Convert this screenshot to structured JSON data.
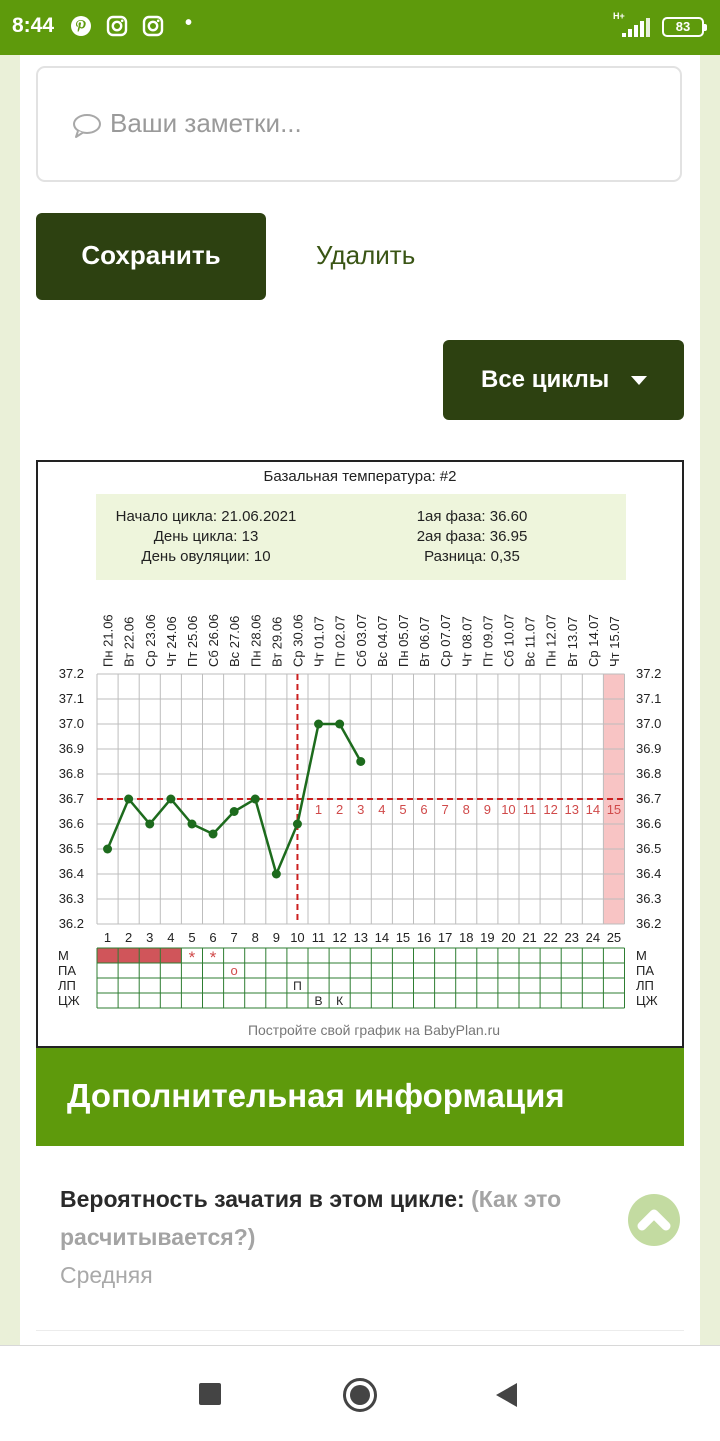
{
  "status_bar": {
    "time": "8:44",
    "network": "H+",
    "battery": "83",
    "icons": [
      "pinterest-icon",
      "instagram-icon",
      "instagram-icon",
      "dot-icon",
      "signal-icon",
      "battery-icon"
    ]
  },
  "notes": {
    "placeholder": "Ваши заметки...",
    "icon": "speech-bubble-icon"
  },
  "buttons": {
    "save": "Сохранить",
    "delete": "Удалить",
    "all_cycles": "Все циклы",
    "all_cycles_icon": "caret-down-icon"
  },
  "chart_data": {
    "type": "line",
    "title": "Базальная температура: #2",
    "info": {
      "cycle_start": "Начало цикла: 21.06.2021",
      "cycle_day": "День цикла: 13",
      "ovulation_day": "День овуляции: 10",
      "phase1": "1ая фаза: 36.60",
      "phase2": "2ая фаза: 36.95",
      "difference": "Разница: 0,35"
    },
    "weekdays": [
      "Пн",
      "Вт",
      "Ср",
      "Чт",
      "Пт",
      "Сб",
      "Вс",
      "Пн",
      "Вт",
      "Ср",
      "Чт",
      "Пт",
      "Сб",
      "Вс",
      "Пн",
      "Вт",
      "Ср",
      "Чт",
      "Пт",
      "Сб",
      "Вс",
      "Пн",
      "Вт",
      "Ср",
      "Чт"
    ],
    "dates": [
      "21.06",
      "22.06",
      "23.06",
      "24.06",
      "25.06",
      "26.06",
      "27.06",
      "28.06",
      "29.06",
      "30.06",
      "01.07",
      "02.07",
      "03.07",
      "04.07",
      "05.07",
      "06.07",
      "07.07",
      "08.07",
      "09.07",
      "10.07",
      "11.07",
      "12.07",
      "13.07",
      "14.07",
      "15.07"
    ],
    "x": [
      1,
      2,
      3,
      4,
      5,
      6,
      7,
      8,
      9,
      10,
      11,
      12,
      13,
      14,
      15,
      16,
      17,
      18,
      19,
      20,
      21,
      22,
      23,
      24,
      25
    ],
    "y_ticks": [
      "36.2",
      "36.3",
      "36.4",
      "36.5",
      "36.6",
      "36.7",
      "36.8",
      "36.9",
      "37.0",
      "37.1",
      "37.2"
    ],
    "ylim": [
      36.2,
      37.2
    ],
    "series": [
      {
        "values": [
          36.5,
          36.7,
          36.6,
          36.7,
          36.6,
          36.56,
          36.65,
          36.7,
          36.4,
          36.6,
          37.0,
          37.0,
          36.85
        ],
        "color": "#1d6b1d"
      }
    ],
    "coverline": 36.7,
    "ovulation_day": 10,
    "luteal_labels": [
      "1",
      "2",
      "3",
      "4",
      "5",
      "6",
      "7",
      "8",
      "9",
      "10",
      "11",
      "12",
      "13",
      "14",
      "15"
    ],
    "highlight_day": 25,
    "row_labels": [
      "М",
      "ПА",
      "ЛП",
      "ЦЖ"
    ],
    "menstruation_days": [
      1,
      2,
      3,
      4
    ],
    "spotting_days": [
      5,
      6
    ],
    "spotting_mark": "*",
    "pa_days": [
      7
    ],
    "pa_mark": "o",
    "lp_days": [
      10
    ],
    "lp_mark": "П",
    "cm_marks": [
      {
        "day": 11,
        "mark": "В"
      },
      {
        "day": 12,
        "mark": "К"
      }
    ],
    "footer": "Постройте свой график на BabyPlan.ru",
    "colors": {
      "line": "#1d6b1d",
      "coverline": "#cc1f1f",
      "luteal": "#d04a4a",
      "menses": "#d0555a",
      "info_bg": "#eef5dc",
      "highlight": "#f8c4c4",
      "grid": "#bdbdbd"
    }
  },
  "info": {
    "title": "Дополнительная информация",
    "probability_label": "Вероятность зачатия в этом цикле:",
    "probability_link": "(Как это расчитывается?)",
    "probability_value": "Средняя",
    "scroll_icon": "chevron-up-icon"
  },
  "nav": {
    "icons": [
      "square-icon",
      "home-circle-icon",
      "back-triangle-icon"
    ]
  }
}
